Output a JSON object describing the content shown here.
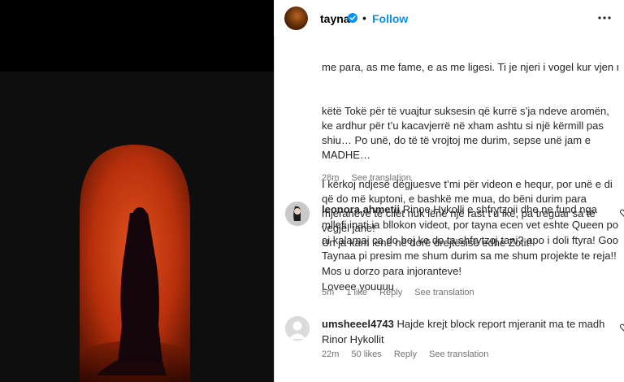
{
  "post": {
    "username": "tayna",
    "dot": "•",
    "follow_label": "Follow",
    "caption_line1": "me para, as me fame, e as me ligesi. Ti je njeri i vogel kur vjen ne",
    "caption_rest": "këtë Tokë për të vuajtur suksesin që kurrë s’ja ndeve aromën, ke ardhur për t’u kacavjerrë në xham ashtu si një kërmill pas shiu… Po unë, do të të vrojtoj me durim, sepse unë jam e MADHE…\n\nI kërkoj ndjesë dëgjuesve t’mi për videon e hequr, por unë e di që do më kuptoni, e bashkë me mua, do bëni durim para mjeranëve të cilët nuk lënë një rast t’u ikë, pa treguar sa të vegjël janë!\nUn ja kam lënë në dorë drejtësisë edhe Zotit!",
    "time": "28m",
    "see_translation": "See translation"
  },
  "comments": [
    {
      "username": "leonora.ahmetii",
      "text": "Rinoe Hykolli e shfrytzoii dhe ne fund nga mllefi inati ia bllokon videot, por tayna ecen vet eshte Queen po ai kalamaj ca do bej ke do ta shfrytzoj tani? apo i doli ftyra! Goo Taynaa pi presim me shum durim sa me shum projekte te reja!! Mos u dorzo para injoranteve!\nLoveee youuuu",
      "time": "5m",
      "likes": "1 like",
      "reply": "Reply",
      "see_translation": "See translation"
    },
    {
      "username": "umsheeel4743",
      "text": "Hajde krejt block report mjeranit ma te madh Rinor Hykollit",
      "time": "22m",
      "likes": "50 likes",
      "reply": "Reply",
      "see_translation": "See translation"
    }
  ],
  "colors": {
    "follow": "#0095f6",
    "verified": "#0095f6",
    "arch_glow": "#c2370f"
  },
  "icons": {
    "verified": "verified-badge-icon",
    "more": "more-options-icon",
    "heart": "heart-icon"
  }
}
